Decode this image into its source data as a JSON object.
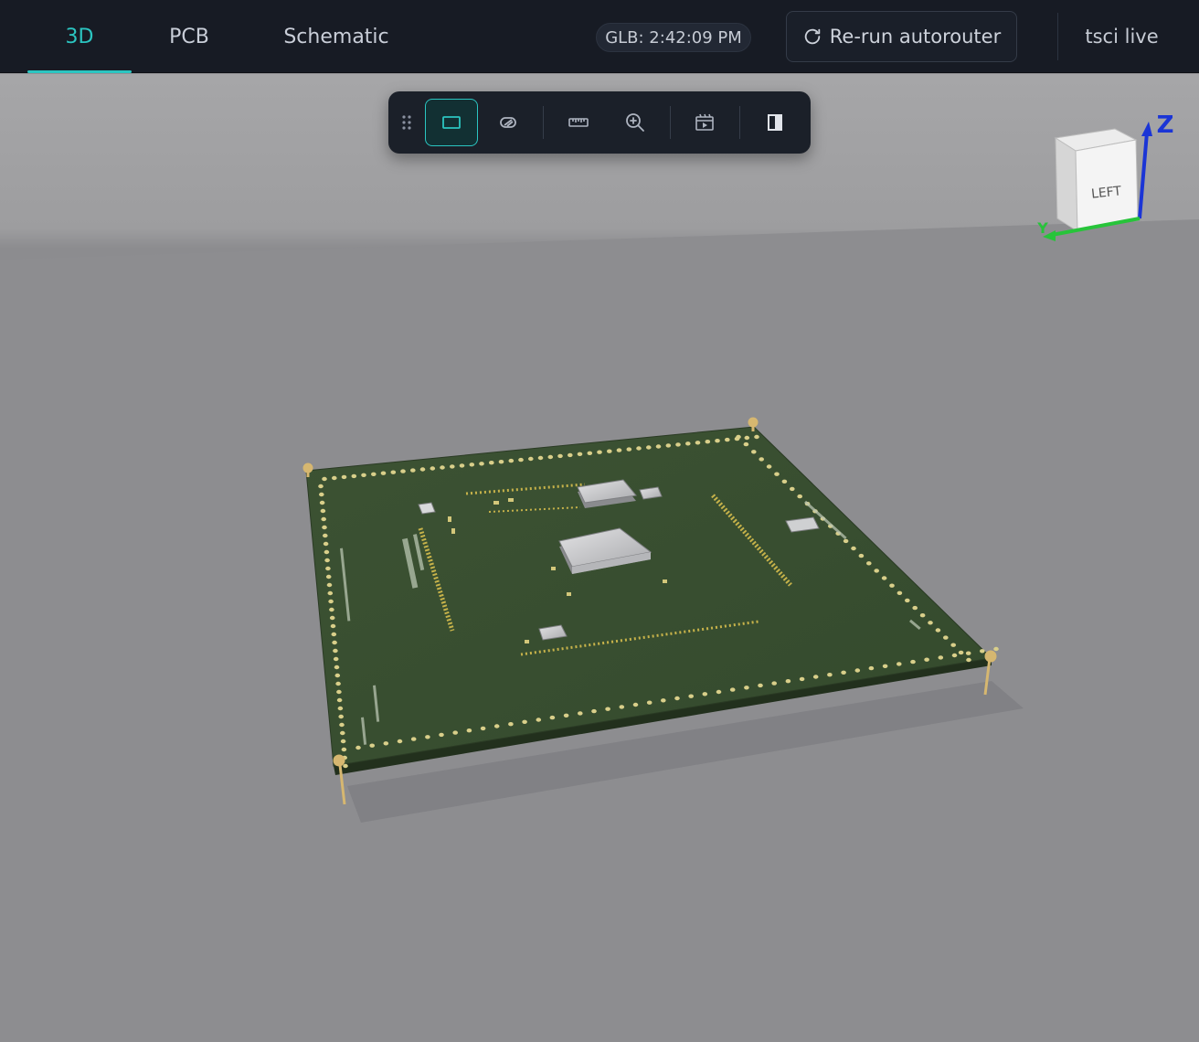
{
  "tabs": [
    {
      "label": "3D",
      "active": true
    },
    {
      "label": "PCB",
      "active": false
    },
    {
      "label": "Schematic",
      "active": false
    }
  ],
  "header": {
    "glb_status": "GLB: 2:42:09 PM",
    "rerun_label": "Re-run autorouter",
    "live_label": "tsci live"
  },
  "toolbar": {
    "tools": [
      {
        "icon": "box-view-icon",
        "active": true
      },
      {
        "icon": "layers-icon",
        "active": false
      },
      {
        "icon": "ruler-icon",
        "active": false
      },
      {
        "icon": "zoom-icon",
        "active": false
      },
      {
        "icon": "animation-icon",
        "active": false
      },
      {
        "icon": "panel-toggle-icon",
        "active": false
      }
    ]
  },
  "gizmo": {
    "face_label": "LEFT",
    "axis_z": "Z",
    "axis_y": "Y"
  },
  "colors": {
    "accent": "#2bc5c1",
    "topbar_bg": "#171b24",
    "board_green": "#3b4f32",
    "scene_floor": "#8f8f92"
  }
}
